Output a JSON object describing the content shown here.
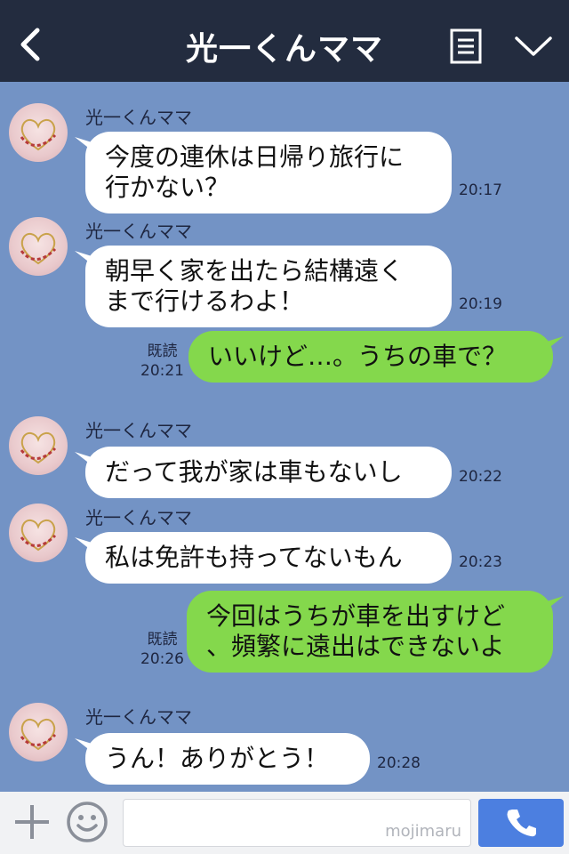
{
  "header": {
    "title": "光一くんママ",
    "back_icon": "chevron-left-icon",
    "menu_icon": "menu-icon",
    "collapse_icon": "chevron-down-icon"
  },
  "messages": [
    {
      "side": "left",
      "sender": "光一くんママ",
      "lines": [
        "今度の連休は日帰り旅行に",
        "行かない？"
      ],
      "time": "20:17"
    },
    {
      "side": "left",
      "sender": "光一くんママ",
      "lines": [
        "朝早く家を出たら結構遠く",
        "まで行けるわよ！"
      ],
      "time": "20:19"
    },
    {
      "side": "right",
      "read": "既読",
      "lines": [
        "いいけど…。うちの車で？"
      ],
      "time": "20:21"
    },
    {
      "side": "left",
      "sender": "光一くんママ",
      "lines": [
        "だって我が家は車もないし"
      ],
      "time": "20:22"
    },
    {
      "side": "left",
      "sender": "光一くんママ",
      "lines": [
        "私は免許も持ってないもん"
      ],
      "time": "20:23"
    },
    {
      "side": "right",
      "read": "既読",
      "lines": [
        "今回はうちが車を出すけど",
        "、頻繁に遠出はできないよ"
      ],
      "time": "20:26"
    },
    {
      "side": "left",
      "sender": "光一くんママ",
      "lines": [
        "うん！ありがとう！"
      ],
      "time": "20:28"
    }
  ],
  "input": {
    "value": "",
    "watermark": "mojimaru"
  },
  "colors": {
    "header_bg": "#232c3f",
    "chat_bg": "#7393c5",
    "own_bubble": "#84d84c",
    "other_bubble": "#ffffff",
    "send_button": "#4c7fe0"
  }
}
